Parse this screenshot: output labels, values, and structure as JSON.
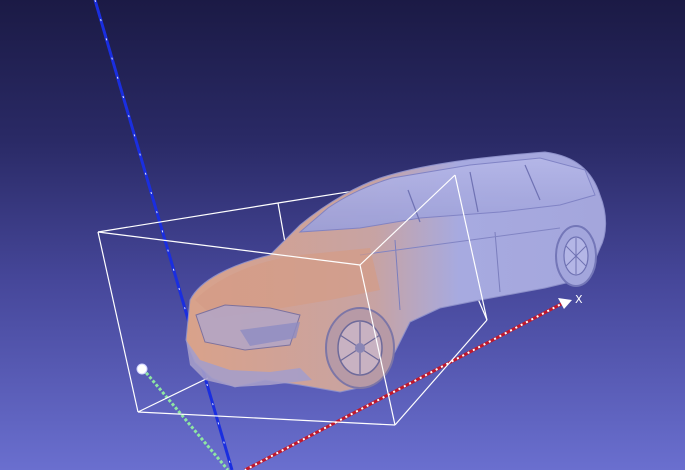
{
  "viewer": {
    "axis_x_label": "X"
  },
  "colors": {
    "background_top": "#1b1a45",
    "background_bottom": "#6a6fcf",
    "mesh_primary": "#a7aae0",
    "mesh_front": "#d9a28a",
    "bounding_box": "#ffffff",
    "axis_x": "#c0182c",
    "axis_y": "#8ee6a3",
    "axis_z": "#1a2ee0"
  },
  "icons": {
    "car_mesh": "car-3d-mesh-icon",
    "trackball_center": "pivot-icon"
  }
}
